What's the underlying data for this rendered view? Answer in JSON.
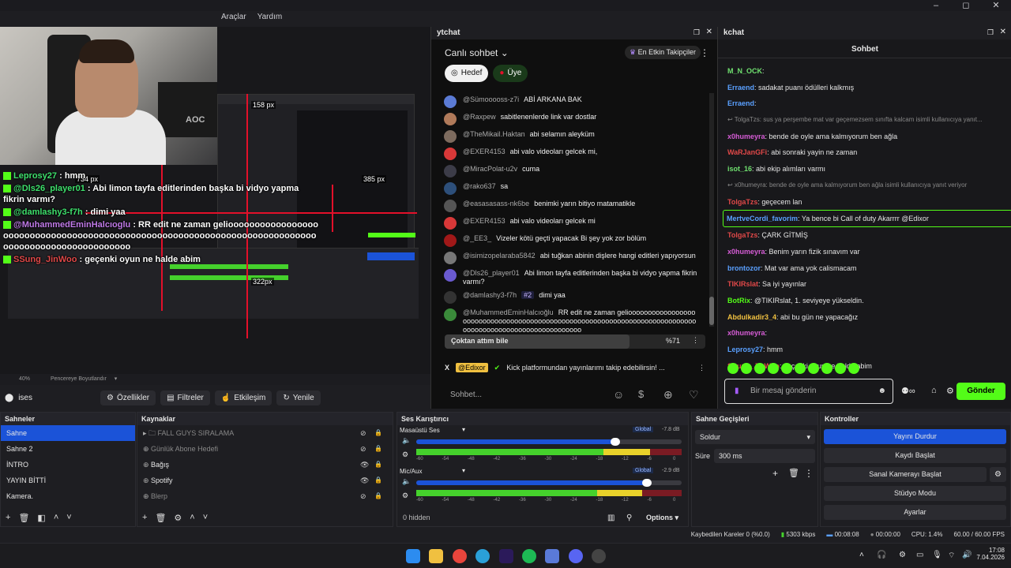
{
  "menu": {
    "tools": "Araçlar",
    "help": "Yardım"
  },
  "window_controls": {
    "minimize": "–",
    "maximize": "◻",
    "close": "✕"
  },
  "preview": {
    "measure_1": "158 px",
    "measure_2": "734 px",
    "measure_3": "385 px",
    "measure_4": "322px",
    "zoom": "40%",
    "fit_label": "Pencereye Boyutlandır",
    "overlay_chat": [
      {
        "user": "Leprosy27",
        "text": ": hmm",
        "color": "g"
      },
      {
        "user": "@Dls26_player01",
        "text": ": Abi limon tayfa editlerinden başka bi vidyo yapma fikrin varmı?",
        "color": "g"
      },
      {
        "user": "@damlashy3-f7h",
        "text": ": dimi yaa",
        "color": "g"
      },
      {
        "user": "@MuhammedEminHalcıoglu",
        "text": ": RR edit ne zaman gelioooooooooooooooooooooooooooooooooooooooooooooooooooooooooooooooooooooooooooooooooooooooooooooooooooo",
        "color": "p"
      },
      {
        "user": "SSung_JinWoo",
        "text": ": geçenki oyun ne halde abim",
        "color": "g"
      }
    ]
  },
  "source_toolbar": {
    "source": "ises",
    "properties": "Özellikler",
    "filters": "Filtreler",
    "interact": "Etkileşim",
    "refresh": "Yenile"
  },
  "ytchat": {
    "title": "ytchat",
    "mode": "Canlı sohbet",
    "top_supporters": "En Etkin Takipçiler",
    "filter_target": "Hedef",
    "filter_member": "Üye",
    "messages": [
      {
        "name": "@Sümooooss-z7i",
        "text": "ABİ ARKANA BAK",
        "color": "#5b7bd5"
      },
      {
        "name": "@Raxpew",
        "text": "sabitlenenlerde link var dostlar",
        "color": "#b07a5a"
      },
      {
        "name": "@TheMikail.Haktan",
        "text": "abi selamın aleyküm",
        "color": "#7d6b5e"
      },
      {
        "name": "@EXER4153",
        "text": "abi valo videoları gelcek mi,",
        "color": "#d83838"
      },
      {
        "name": "@MiracPolat-u2v",
        "text": "cuma",
        "color": "#3c3c48"
      },
      {
        "name": "@rako637",
        "text": "sa",
        "color": "#2d4f7a"
      },
      {
        "name": "@easasasass-nk6be",
        "text": "benimki yarın bitiyo matamatikle",
        "color": "#555"
      },
      {
        "name": "@EXER4153",
        "text": "abi valo videoları gelcek mi",
        "color": "#d83838"
      },
      {
        "name": "@_EE3_",
        "text": "Vizeler kötü geçti yapacak Bi şey yok zor bölüm",
        "color": "#a01818"
      },
      {
        "name": "@isimizopelaraba5842",
        "text": "abi tuğkan abinin dişlere hangi editleri yapıyorsun",
        "color": "#777"
      },
      {
        "name": "@Dls26_player01",
        "text": "Abi limon tayfa editlerinden başka bi vidyo yapma fikrin varmı?",
        "color": "#6a5ad0"
      },
      {
        "name": "@damlashy3-f7h",
        "text": "dimi yaa",
        "badge": "#2",
        "color": "#333"
      },
      {
        "name": "@MuhammedEminHalcıoğlu",
        "text": "RR edit ne zaman gelioooooooooooooooooooooooooooooooooooooooooooooooooooooooooooooooooooooooooooooooooooooooooooooooooooooooooo",
        "color": "#3a8a3a"
      }
    ],
    "poll_label": "Çoktan attım bile",
    "poll_pct": "%71",
    "poll_value": 0.71,
    "pinned_user": "@Edixor",
    "pinned_text": "Kick platformundan yayınlarımı takip edebilirsin! ...",
    "input_placeholder": "Sohbet..."
  },
  "kick": {
    "title": "kchat",
    "subtitle": "Sohbet",
    "messages": [
      {
        "user": "M_N_OCK",
        "text": ":",
        "color": "#6fe06f"
      },
      {
        "user": "Erraend",
        "text": ": sadakat puanı ödülleri kalkmış",
        "color": "#5aa0ff"
      },
      {
        "user": "Erraend",
        "text": ":",
        "color": "#5aa0ff"
      },
      {
        "reply": "TolgaTzs: sus ya perşembe mat var geçemezsem sınıfta kalcam isimli kullanıcıya yanıt..."
      },
      {
        "user": "x0humeyra",
        "text": ": bende de oyle ama kalmıyorum ben ağla",
        "color": "#d65cd6"
      },
      {
        "user": "WaRJanGFi",
        "text": ": abi sonraki yayin ne zaman",
        "color": "#e04848"
      },
      {
        "user": "isot_16",
        "text": ": abi ekip alımları varmı",
        "color": "#6fe06f"
      },
      {
        "reply": "x0humeyra: bende de oyle ama kalmıyorum ben ağla isimli kullanıcıya yanıt veriyor"
      },
      {
        "user": "TolgaTzs",
        "text": ": geçecem lan",
        "color": "#e04848"
      },
      {
        "user": "MertveCordi_favorim",
        "text": ": Ya bence bi Call of duty Akarrrr @Edixor",
        "color": "#5aa0ff",
        "highlight": true
      },
      {
        "user": "TolgaTzs",
        "text": ": ÇARK GİTMİŞ",
        "color": "#e04848"
      },
      {
        "user": "x0humeyra",
        "text": ": Benim yarın fizik sınavım var",
        "color": "#d65cd6"
      },
      {
        "user": "brontozor",
        "text": ": Mat var ama yok calismacam",
        "color": "#5aa0ff"
      },
      {
        "user": "TIKIRslat",
        "text": ": Sa iyi yayınlar",
        "color": "#e04848"
      },
      {
        "user": "BotRix",
        "text": ": @TIKIRslat, 1. seviyeye yükseldin.",
        "color": "#53fc18"
      },
      {
        "user": "Abdulkadir3_4",
        "text": ": abi bu gün ne yapacağız",
        "color": "#f0c040"
      },
      {
        "user": "x0humeyra",
        "text": ":",
        "color": "#d65cd6"
      },
      {
        "user": "Leprosy27",
        "text": ": hmm",
        "color": "#5aa0ff"
      },
      {
        "user": "SSung_JinWoo",
        "text": ": geçenki oyun ne halde abim",
        "color": "#e04848"
      }
    ],
    "input_placeholder": "Bir mesaj gönderin",
    "send": "Gönder"
  },
  "scenes": {
    "title": "Sahneler",
    "items": [
      "Sahne",
      "Sahne 2",
      "İNTRO",
      "YAYIN BİTTİ",
      "Kamera."
    ]
  },
  "sources": {
    "title": "Kaynaklar",
    "items": [
      "FALL GUYS SIRALAMA",
      "Günlük Abone Hedefi",
      "Bağış",
      "Spotify",
      "Blerp"
    ]
  },
  "mixer": {
    "title": "Ses Karıştırıcı",
    "channels": [
      {
        "name": "Masaüstü Ses",
        "tag": "Global",
        "db": "-7.8 dB",
        "level": 0.88,
        "volume": 0.75
      },
      {
        "name": "Mic/Aux",
        "tag": "Global",
        "db": "-2.9 dB",
        "level": 0.85,
        "volume": 0.87
      }
    ],
    "ticks": [
      "-60",
      "-54",
      "-48",
      "-42",
      "-36",
      "-30",
      "-24",
      "-18",
      "-12",
      "-6",
      "0"
    ],
    "hidden": "0 hidden",
    "options": "Options"
  },
  "transitions": {
    "title": "Sahne Geçişleri",
    "type": "Soldur",
    "duration_label": "Süre",
    "duration": "300 ms"
  },
  "controls": {
    "title": "Kontroller",
    "buttons": [
      "Yayını Durdur",
      "Kaydı Başlat",
      "Sanal Kamerayı Başlat",
      "Stüdyo Modu",
      "Ayarlar"
    ]
  },
  "status": {
    "dropped": "Kaybedilen Kareler 0 (%0.0)",
    "kbps": "5303 kbps",
    "stream_time": "00:08:08",
    "rec_time": "00:00:00",
    "cpu": "CPU: 1.4%",
    "fps": "60.00 / 60.00 FPS"
  },
  "taskbar": {
    "time": "17:08",
    "date": "7.04.2026"
  },
  "colors": {
    "accent": "#1b53d8",
    "kick_green": "#53fc18",
    "overlay_red": "#e3102a"
  }
}
